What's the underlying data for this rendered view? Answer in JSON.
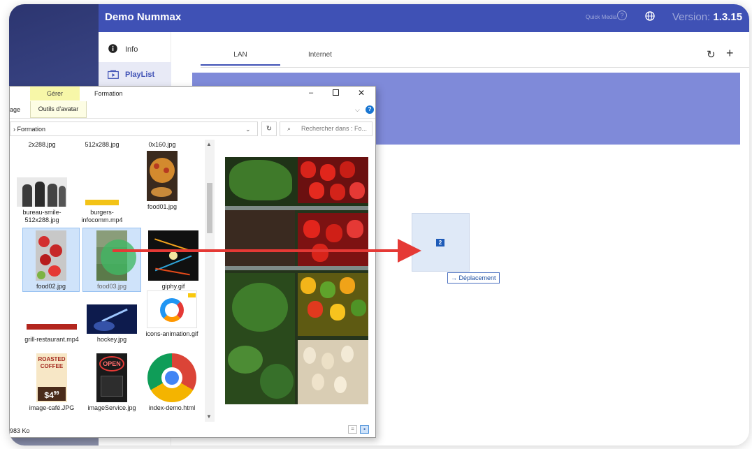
{
  "app": {
    "title": "Demo Nummax",
    "quick_media": "Quick Media",
    "version_label": "Version:",
    "version_value": "1.3.15"
  },
  "sidebar": {
    "items": [
      {
        "label": "Info",
        "icon": "info-icon"
      },
      {
        "label": "PlayList",
        "icon": "playlist-icon",
        "active": true
      }
    ]
  },
  "tabs": [
    {
      "label": "LAN",
      "active": true
    },
    {
      "label": "Internet",
      "active": false
    }
  ],
  "colors": {
    "primary": "#3f51b5",
    "banner": "#7f8ad9",
    "drag_arrow": "#e53935",
    "drag_cursor": "#40b964"
  },
  "drag": {
    "badge": "2",
    "label": "Déplacement"
  },
  "explorer": {
    "ribbon_tab_manage": "Gérer",
    "ribbon_tab_name": "Formation",
    "ribbon_image_partial": "age",
    "ribbon_avatar_tools": "Outils d’avatar",
    "address_prefix": "› Formation",
    "search_placeholder": "Rechercher dans : Fo...",
    "status_partial": "983 Ko",
    "files": [
      {
        "name": "2x288.jpg"
      },
      {
        "name": "512x288.jpg"
      },
      {
        "name": "0x160.jpg"
      },
      {
        "name": "bureau-smile-512x288.jpg"
      },
      {
        "name": "burgers-infocomm.mp4"
      },
      {
        "name": "food01.jpg"
      },
      {
        "name": "food02.jpg",
        "selected": true
      },
      {
        "name": "food03.jpg",
        "selected": true
      },
      {
        "name": "giphy.gif"
      },
      {
        "name": "grill-restaurant.mp4"
      },
      {
        "name": "hockey.jpg"
      },
      {
        "name": "icons-animation.gif"
      },
      {
        "name": "image-café.JPG"
      },
      {
        "name": "imageService.jpg"
      },
      {
        "name": "index-demo.html"
      }
    ],
    "thumb_text": {
      "roasted": "ROASTED",
      "coffee": "COFFEE",
      "price": "$4",
      "price_cents": "99",
      "open": "OPEN"
    }
  }
}
